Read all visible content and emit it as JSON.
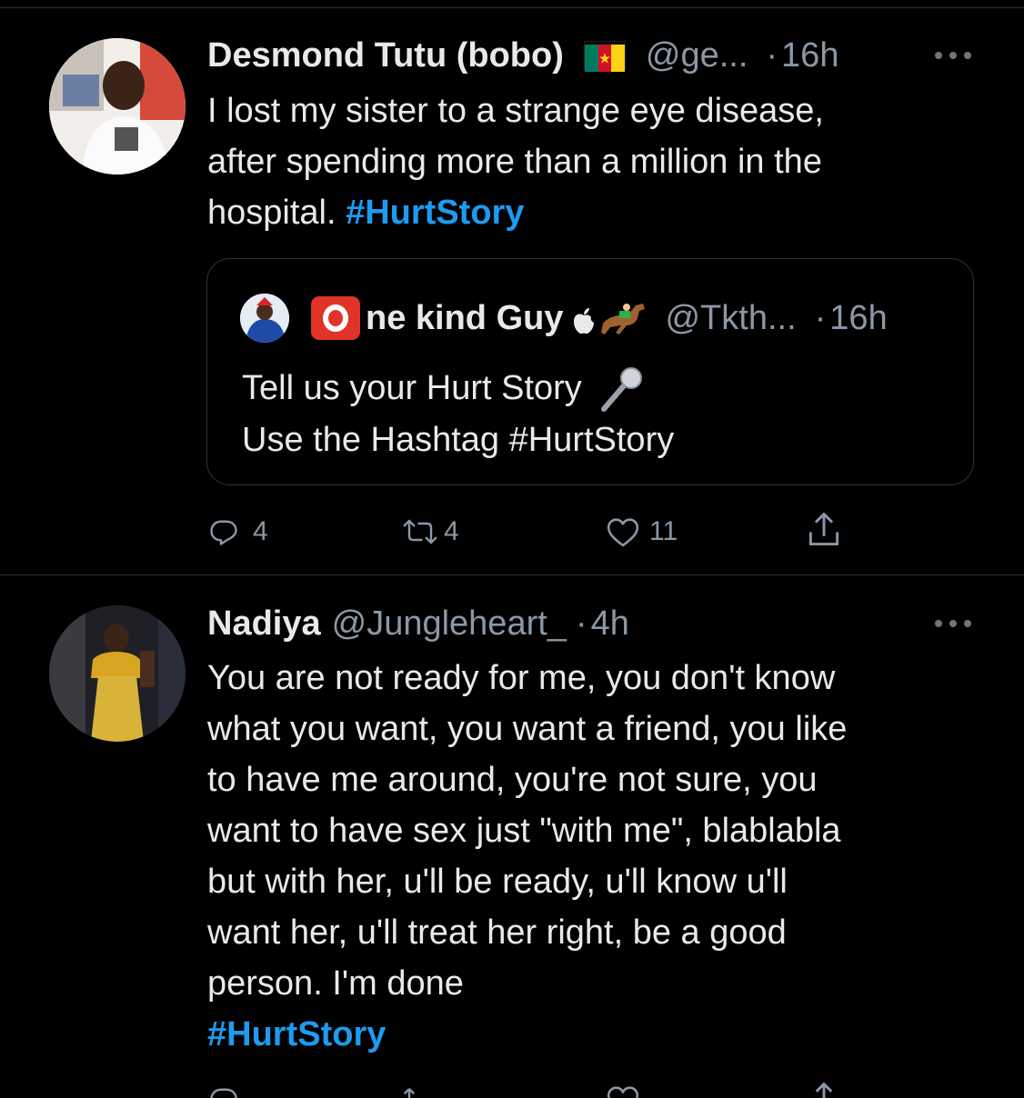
{
  "tweets": [
    {
      "name": "Desmond Tutu (bobo)",
      "handle": "@ge...",
      "dot": "·",
      "time": "16h",
      "text": "I lost my sister to a strange eye disease,\nafter spending more than a million in the\nhospital. ",
      "hashtag": "#HurtStory",
      "quote": {
        "name": "ne kind Guy",
        "handle": "@Tkth...",
        "dot": "·",
        "time": "16h",
        "text_line1": "Tell us your Hurt Story",
        "text_line2": "Use the Hashtag #HurtStory"
      },
      "stats": {
        "replies": "4",
        "retweets": "4",
        "likes": "11"
      }
    },
    {
      "name": "Nadiya",
      "handle": "@Jungleheart_",
      "dot": "·",
      "time": "4h",
      "text": "You are not ready for me, you don't know\nwhat you want, you want a friend, you like\nto have me around, you're not sure, you\nwant to have sex just \"with me\", blablabla\nbut with her, u'll be ready, u'll know u'll\nwant her, u'll treat her right, be a good\nperson. I'm done",
      "hashtag": "#HurtStory"
    }
  ],
  "colors": {
    "background": "#000000",
    "text": "#e7e9ea",
    "secondary": "#8b98a5",
    "accent": "#1d9bf0",
    "border": "#2f3336"
  },
  "icons": {
    "reply": "reply-icon",
    "retweet": "retweet-icon",
    "like": "heart-icon",
    "share": "share-icon",
    "more": "more-icon"
  }
}
